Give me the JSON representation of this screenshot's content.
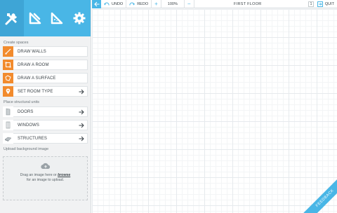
{
  "sidebar": {
    "tabs": [
      {
        "icon": "tools-icon",
        "active": true
      },
      {
        "icon": "set-square-icon",
        "active": false
      },
      {
        "icon": "ruler-triangle-icon",
        "active": false
      },
      {
        "icon": "gear-icon",
        "active": false
      }
    ],
    "create_spaces": {
      "title": "Create spaces",
      "items": [
        {
          "label": "DRAW WALLS",
          "icon": "draw-walls-icon"
        },
        {
          "label": "DRAW A ROOM",
          "icon": "draw-room-icon"
        },
        {
          "label": "DRAW A SURFACE",
          "icon": "draw-surface-icon"
        },
        {
          "label": "SET ROOM TYPE",
          "icon": "location-pin-icon"
        }
      ]
    },
    "structural_units": {
      "title": "Place structural units",
      "items": [
        {
          "label": "DOORS",
          "icon": "door-icon"
        },
        {
          "label": "WINDOWS",
          "icon": "window-icon"
        },
        {
          "label": "STRUCTURES",
          "icon": "structure-icon"
        }
      ]
    },
    "upload": {
      "title": "Upload background image",
      "text_before": "Drag an image here or",
      "link": "browse",
      "text_after": "for an image to upload."
    }
  },
  "toolbar": {
    "undo_label": "UNDO",
    "redo_label": "REDO",
    "zoom_value": "100%",
    "floor_label": "FIRST FLOOR",
    "floor_number": "1",
    "quit_label": "QUIT"
  },
  "feedback_label": "FEEDBACK",
  "colors": {
    "accent": "#49b6e6",
    "orange": "#f28b2d",
    "sidebar_bg": "#f1f2f3"
  }
}
